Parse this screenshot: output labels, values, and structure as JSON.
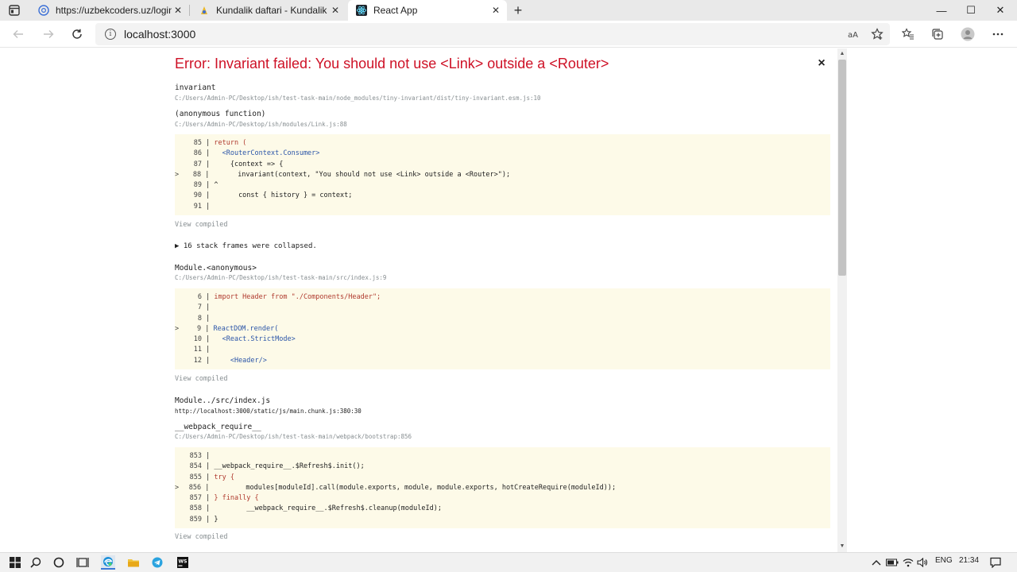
{
  "browser": {
    "tabs": [
      {
        "title": "https://uzbekcoders.uz/login",
        "active": false
      },
      {
        "title": "Kundalik daftari - Kundalik",
        "active": false
      },
      {
        "title": "React App",
        "active": true
      }
    ],
    "new_tab": "+",
    "window_controls": {
      "minimize": "—",
      "maximize": "☐",
      "close": "✕"
    },
    "address": "localhost:3000",
    "info_glyph": "i"
  },
  "error": {
    "title": "Error: Invariant failed: You should not use <Link> outside a <Router>",
    "close": "×",
    "view_compiled": "View compiled",
    "collapsed": "▶ 16 stack frames were collapsed.",
    "frames": [
      {
        "fn": "invariant",
        "path": "C:/Users/Admin-PC/Desktop/ish/test-task-main/node_modules/tiny-invariant/dist/tiny-invariant.esm.js:10"
      },
      {
        "fn": "(anonymous function)",
        "path": "C:/Users/Admin-PC/Desktop/ish/modules/Link.js:88"
      },
      {
        "fn": "Module.<anonymous>",
        "path": "C:/Users/Admin-PC/Desktop/ish/test-task-main/src/index.js:9"
      },
      {
        "fn": "Module../src/index.js",
        "path": "http://localhost:3000/static/js/main.chunk.js:380:30"
      },
      {
        "fn": "__webpack_require__",
        "path": "C:/Users/Admin-PC/Desktop/ish/test-task-main/webpack/bootstrap:856"
      }
    ],
    "code_blocks": [
      {
        "lines": [
          {
            "mark": "",
            "num": "85",
            "code": "return ("
          },
          {
            "mark": "",
            "num": "86",
            "code": "  <RouterContext.Consumer>"
          },
          {
            "mark": "",
            "num": "87",
            "code": "    {context => {"
          },
          {
            "mark": ">",
            "num": "88",
            "code": "      invariant(context, \"You should not use <Link> outside a <Router>\");"
          },
          {
            "mark": "",
            "num": "89",
            "code": "^"
          },
          {
            "mark": "",
            "num": "90",
            "code": "      const { history } = context;"
          },
          {
            "mark": "",
            "num": "91",
            "code": ""
          }
        ]
      },
      {
        "lines": [
          {
            "mark": "",
            "num": "6",
            "code": "import Header from \"./Components/Header\";"
          },
          {
            "mark": "",
            "num": "7",
            "code": ""
          },
          {
            "mark": "",
            "num": "8",
            "code": ""
          },
          {
            "mark": ">",
            "num": "9",
            "code": "ReactDOM.render("
          },
          {
            "mark": "",
            "num": "10",
            "code": "  <React.StrictMode>"
          },
          {
            "mark": "",
            "num": "11",
            "code": ""
          },
          {
            "mark": "",
            "num": "12",
            "code": "    <Header/>"
          }
        ]
      },
      {
        "lines": [
          {
            "mark": "",
            "num": "853",
            "code": ""
          },
          {
            "mark": "",
            "num": "854",
            "code": "__webpack_require__.$Refresh$.init();"
          },
          {
            "mark": "",
            "num": "855",
            "code": "try {"
          },
          {
            "mark": ">",
            "num": "856",
            "code": "        modules[moduleId].call(module.exports, module, module.exports, hotCreateRequire(moduleId));"
          },
          {
            "mark": "",
            "num": "857",
            "code": "} finally {"
          },
          {
            "mark": "",
            "num": "858",
            "code": "        __webpack_require__.$Refresh$.cleanup(moduleId);"
          },
          {
            "mark": "",
            "num": "859",
            "code": "}"
          }
        ]
      }
    ]
  },
  "taskbar": {
    "language": "ENG",
    "time": "21:34"
  },
  "colors": {
    "error_red": "#ce1126",
    "code_bg": "#fdfae8",
    "path_gray": "#878e91"
  }
}
